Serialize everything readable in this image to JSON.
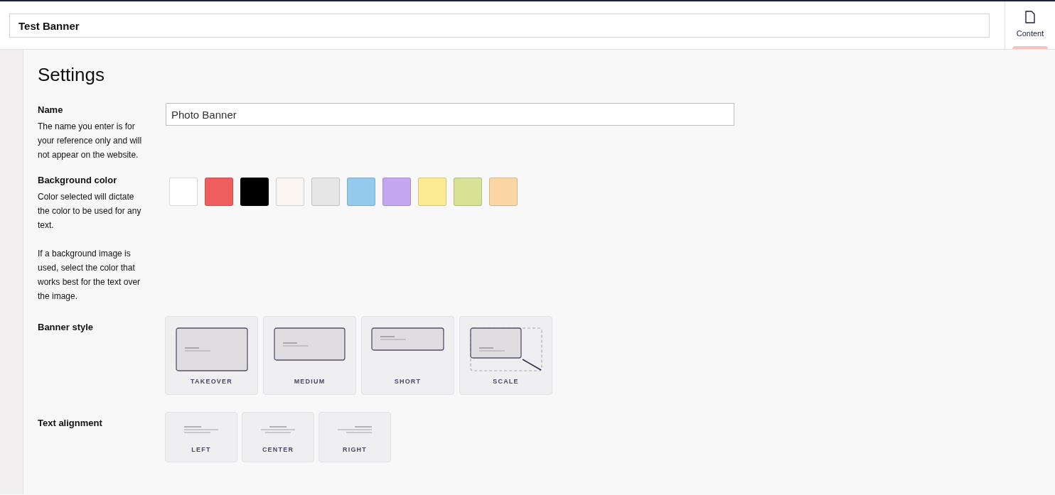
{
  "title_field": {
    "value": "Test Banner"
  },
  "tabs": [
    {
      "label": "Content",
      "selected": true
    }
  ],
  "heading": "Settings",
  "name_setting": {
    "label": "Name",
    "description": "The name you enter is for your reference only and will not appear on the website.",
    "value": "Photo Banner"
  },
  "background_color": {
    "label": "Background color",
    "descriptions": [
      "Color selected will dictate the color to be used for any text.",
      "If a background image is used, select the color that works best for the text over the image."
    ],
    "swatches": [
      {
        "color": "#ffffff"
      },
      {
        "color": "#ef5f5f"
      },
      {
        "color": "#000000"
      },
      {
        "color": "#faf5f0"
      },
      {
        "color": "#e6e6e6"
      },
      {
        "color": "#94caed"
      },
      {
        "color": "#c3a8f0"
      },
      {
        "color": "#fceb91"
      },
      {
        "color": "#d7e296"
      },
      {
        "color": "#fbd6a4"
      }
    ]
  },
  "banner_style": {
    "label": "Banner style",
    "options": [
      {
        "kind": "takeover",
        "label": "TAKEOVER"
      },
      {
        "kind": "medium",
        "label": "MEDIUM"
      },
      {
        "kind": "short",
        "label": "SHORT"
      },
      {
        "kind": "scale",
        "label": "SCALE"
      }
    ]
  },
  "text_alignment": {
    "label": "Text alignment",
    "options": [
      {
        "kind": "left",
        "label": "LEFT"
      },
      {
        "kind": "center",
        "label": "CENTER"
      },
      {
        "kind": "right",
        "label": "RIGHT"
      }
    ]
  }
}
